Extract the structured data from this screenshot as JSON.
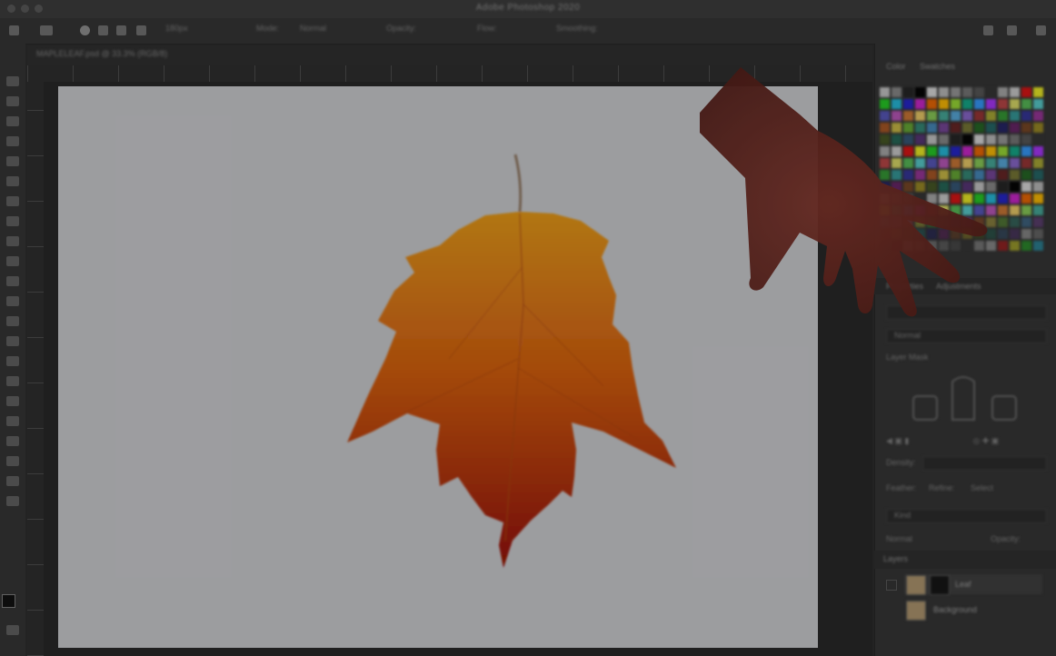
{
  "app": {
    "title": "Adobe Photoshop 2020"
  },
  "options_bar": {
    "size_value": "180px",
    "mode_label": "Mode:",
    "mode_value": "Normal",
    "opacity_label": "Opacity:",
    "flow_label": "Flow:",
    "smoothing_label": "Smoothing:"
  },
  "document": {
    "tab_label": "MAPLELEAF.psd @ 33.3% (RGB/8)"
  },
  "panels": {
    "color_tab": "Color",
    "swatches_tab": "Swatches",
    "properties_tab": "Properties",
    "adjustments_tab": "Adjustments",
    "properties_mode": "Normal",
    "layer_mask_label": "Layer Mask",
    "density_label": "Density:",
    "feather_label": "Feather:",
    "refine_label": "Refine:",
    "select_subject": "Select",
    "layers_tab": "Layers",
    "kind_label": "Kind",
    "blend_mode": "Normal",
    "opacity_label": "Opacity:"
  },
  "layers": [
    {
      "name": "Leaf"
    },
    {
      "name": "Background"
    }
  ],
  "icons": {
    "move": "move-icon",
    "brush": "brush-icon",
    "eraser": "eraser-icon",
    "zoom": "zoom-icon",
    "hand": "hand-icon"
  },
  "colors": {
    "canvas": "#bfc0c3",
    "leaf_top": "#d88a14",
    "leaf_bottom": "#9a1408",
    "hand": "#6a2b24"
  }
}
